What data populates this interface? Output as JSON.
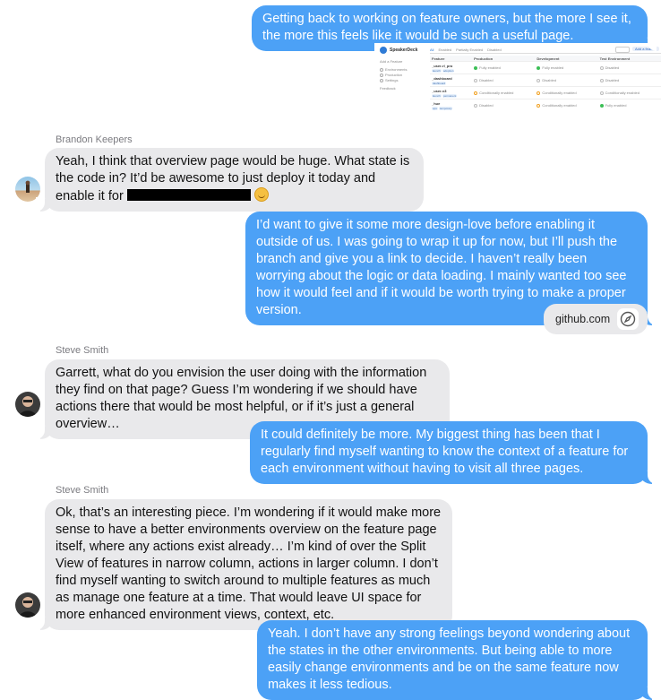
{
  "messages": {
    "m1": {
      "text": "Getting back to working on feature owners, but the more I see it, the more this feels like it would be such a useful page."
    },
    "m2": {
      "sender": "Brandon Keepers",
      "text": "Yeah, I think that overview page would be huge. What state is the code in? It’d be awesome to just deploy it today and enable it for"
    },
    "m3": {
      "text": "I’d want to give it some more design-love before enabling it outside of us. I was going to wrap it up for now, but I’ll push the branch and give you a link to decide. I haven’t really been worrying about the logic or data loading. I mainly wanted too see how it would feel and if it would be worth trying to make a proper version."
    },
    "m4": {
      "link": "github.com"
    },
    "m5": {
      "sender": "Steve Smith",
      "text": "Garrett, what do you envision the user doing with the information they find on that page? Guess I’m wondering if we should have actions there that would be most helpful, or if it’s just a general overview…"
    },
    "m6": {
      "text": "It could definitely be more. My biggest thing has been that I regularly find myself wanting to know the context of a feature for each environment without having to visit all three pages."
    },
    "m7": {
      "sender": "Steve Smith",
      "text": "Ok, that’s an interesting piece. I’m wondering if it would make more sense to have a better environments overview on the feature page itself, where any actions exist already… I’m kind of over the Split View of features in narrow column, actions in larger column. I don’t find myself wanting to switch around to multiple features as much as manage one feature at a time. That would leave UI space for more enhanced environment views, context, etc."
    },
    "m8": {
      "text": "Yeah. I don’t have any strong feelings beyond wondering about the states in the other environments. But being able to more easily change environments and be on the same feature now makes it less tedious."
    }
  },
  "screenshot": {
    "brand": "SpeakerDeck",
    "nav": [
      "Add a Feature",
      "Environments",
      "Production",
      "Settings",
      "Feedback"
    ],
    "tabs": [
      "All",
      "Enabled",
      "Partially Enabled",
      "Disabled"
    ],
    "add_button": "Add a feature",
    "headers": [
      "Feature",
      "Production",
      "Development",
      "Test Environment"
    ],
    "rows": [
      {
        "name": "_user-rl_pro",
        "tags": [
          "launch",
          "adoption"
        ],
        "cells": [
          [
            "green",
            "Fully enabled"
          ],
          [
            "green",
            "Fully enabled"
          ],
          [
            "gray",
            "Disabled"
          ]
        ]
      },
      {
        "name": "_dashboard",
        "tags": [
          "dashboard"
        ],
        "cells": [
          [
            "gray",
            "Disabled"
          ],
          [
            "gray",
            "Disabled"
          ],
          [
            "gray",
            "Disabled"
          ]
        ]
      },
      {
        "name": "_user-v3",
        "tags": [
          "launch",
          "permanent"
        ],
        "cells": [
          [
            "orange",
            "Conditionally enabled"
          ],
          [
            "orange",
            "Conditionally enabled"
          ],
          [
            "gray",
            "Conditionally enabled"
          ]
        ]
      },
      {
        "name": "_hue",
        "tags": [
          "ops",
          "temporary"
        ],
        "cells": [
          [
            "gray",
            "Disabled"
          ],
          [
            "orange",
            "Conditionally enabled"
          ],
          [
            "green",
            "Fully enabled"
          ]
        ]
      }
    ]
  },
  "colors": {
    "outgoing": "#4ca1f6",
    "incoming": "#e9e9eb"
  },
  "icons": {
    "link": "compass-icon"
  }
}
